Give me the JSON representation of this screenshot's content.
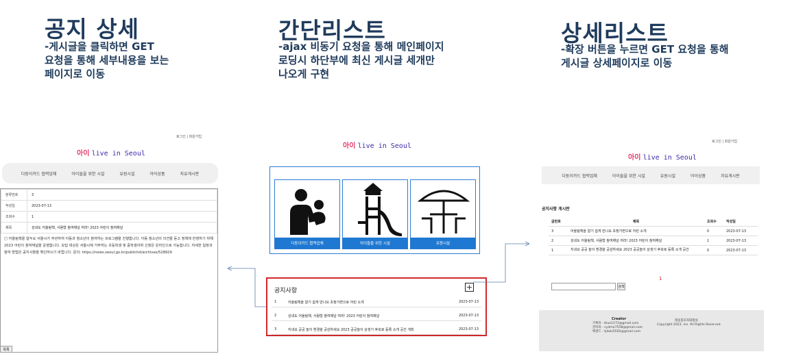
{
  "sections": {
    "detail": {
      "title": "공지 상세",
      "desc1": "-게시글을 클릭하면 GET",
      "desc2": "요청을 통해 세부내용을 보는",
      "desc3": "페이지로 이동"
    },
    "simple": {
      "title": "간단리스트",
      "desc1": "-ajax 비동기 요청을 통해 메인페이지",
      "desc2": "로딩시 하단부에 최신 게시글 세개만",
      "desc3": "나오게 구현"
    },
    "list": {
      "title": "상세리스트",
      "desc1": "-확장 버튼을 누르면 GET 요청을 통해",
      "desc2": "게시글 상세페이지로 이동"
    }
  },
  "brand": {
    "korean": "아이",
    "english": "live in Seoul"
  },
  "top_links": {
    "left": "로그인 | 회원가입",
    "right": "로그인 | 회원가입"
  },
  "nav": [
    "다둥이카드 협력업체",
    "아이들을 위한 시설",
    "유원시설",
    "아이상품",
    "자유게시판"
  ],
  "detail": {
    "rows": [
      {
        "k": "분류번호",
        "v": "3"
      },
      {
        "k": "작성일",
        "v": "2023-07-13"
      },
      {
        "k": "조회수",
        "v": "1"
      },
      {
        "k": "제목",
        "v": "성내도 어울림책, 사람형 참여채널 여러! 2023 아린이 참여채널"
      }
    ],
    "content": "□ 어울림책을 알두요 서울시가 주관하여 아동과 청소년이 참여하는 프로그램을 진행합니다. 아동·청소년의 의견을 듣고 정책에 반영하기 위해 2023 어린이 참여채널을 운영합니다. 모집 대상은 서울시에 거주하는 초등학생 및 중학생이며 신청은 온라인으로 가능합니다. 자세한 일정과 참여 방법은 공지사항을 확인하시기 바랍니다. 문의: https://news.seoul.go.kr/publichd/archives/528929",
    "footer_button": "목록"
  },
  "cards": [
    {
      "label": "다둥이카드 협력업체",
      "icon": "family-icon"
    },
    {
      "label": "아이들을 위한 시설",
      "icon": "playground-icon"
    },
    {
      "label": "유원시설",
      "icon": "parasol-icon"
    }
  ],
  "simple_list": {
    "title": "공지사항",
    "plus": "+",
    "rows": [
      {
        "num": "1",
        "title": "어울림책을 알기 쉽게 만나요 초청가면으로 어린 소개",
        "date": "2023-07-13"
      },
      {
        "num": "2",
        "title": "성내도 어울림책, 사람형 참여채널 여러! 2023 어린이 참여채널",
        "date": "2023-07-13"
      },
      {
        "num": "3",
        "title": "지내요 공공 놀이 환경을 공감하세요 2023 공공놀이 상생기 후보로 등록 소개 공간 개최",
        "date": "2023-07-13"
      }
    ]
  },
  "board": {
    "title": "공지사항 게시판",
    "headers": [
      "글번호",
      "제목",
      "조회수",
      "작성일"
    ],
    "rows": [
      {
        "num": "3",
        "title": "어울림책을 알기 쉽게 만나요 초청가면으로 어린 소개",
        "views": "0",
        "date": "2023-07-13"
      },
      {
        "num": "2",
        "title": "성내도 어울림책, 사람형 참여채널 여러! 2023 어린이 참여채널",
        "views": "1",
        "date": "2023-07-13"
      },
      {
        "num": "1",
        "title": "지내요 공공 놀이 환경을 공감하세요 2023 공공놀이 상생기 후보로 등록 소개 공간",
        "views": "0",
        "date": "2023-07-13"
      }
    ],
    "page": "1",
    "search_button": "검색",
    "search_value": ""
  },
  "footer": {
    "creator_title": "Creator",
    "creators": [
      "기획자 - blue1172@gmail.com",
      "관리자 - cydme7558@gmail.com",
      "백엔드 - tjdals5502@gmail.com"
    ],
    "brand_line": "레옹봉호자대형실",
    "copyright": "Copyright 2023. ins. All Rights Reserved."
  },
  "colors": {
    "accent": "#1f78d1",
    "highlight": "#d0262b",
    "heading": "#1f3b5c"
  }
}
